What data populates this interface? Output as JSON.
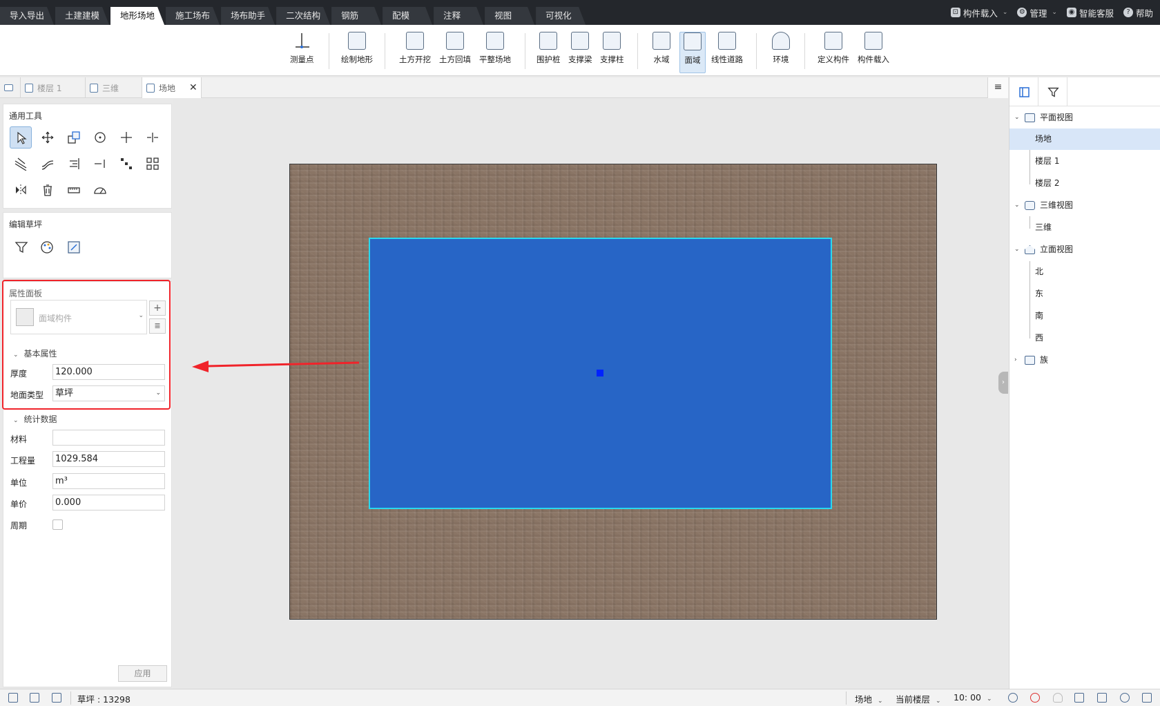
{
  "menubar": {
    "tabs": [
      "导入导出",
      "土建建模",
      "地形场地",
      "施工场布",
      "场布助手",
      "二次结构",
      "钢筋",
      "配模",
      "注释",
      "视图",
      "可视化"
    ],
    "active_tab": "地形场地",
    "right": {
      "component_load": "构件载入",
      "manage": "管理",
      "smart_service": "智能客服",
      "help": "帮助"
    }
  },
  "ribbon": {
    "survey_point": "测量点",
    "draw_terrain": "绘制地形",
    "excavation": "土方开挖",
    "backfill": "土方回填",
    "level_site": "平整场地",
    "retaining_pile": "围护桩",
    "support_beam": "支撑梁",
    "support_column": "支撑柱",
    "water_area": "水域",
    "surface_area": "面域",
    "linear_road": "线性道路",
    "environment": "环境",
    "define_component": "定义构件",
    "load_component": "构件载入",
    "selected": "面域"
  },
  "doc_tabs": {
    "floor1": "楼层 1",
    "view3d": "三维",
    "site": "场地"
  },
  "left_panel": {
    "general_tools_title": "通用工具",
    "edit_lawn_title": "编辑草坪",
    "property_panel_title": "属性面板",
    "component_selector": "面域构件",
    "basic_properties": "基本属性",
    "thickness_label": "厚度",
    "thickness_value": "120.000",
    "ground_type_label": "地面类型",
    "ground_type_value": "草坪",
    "statistics": "统计数据",
    "material_label": "材料",
    "material_value": "",
    "quantity_label": "工程量",
    "quantity_value": "1029.584",
    "unit_label": "单位",
    "unit_value": "m³",
    "price_label": "单价",
    "price_value": "0.000",
    "period_label": "周期",
    "apply_button": "应用"
  },
  "right_panel": {
    "plan_view": "平面视图",
    "site": "场地",
    "floor1": "楼层 1",
    "floor2": "楼层 2",
    "view3d_group": "三维视图",
    "view3d": "三维",
    "elevation_view": "立面视图",
    "north": "北",
    "east": "东",
    "south": "南",
    "west": "西",
    "family": "族"
  },
  "statusbar": {
    "selection_info": "草坪 : 13298",
    "site": "场地",
    "current_floor": "当前楼层",
    "time": "10: 00"
  },
  "colors": {
    "area_fill": "#2765c6",
    "area_border": "#29d8ee",
    "highlight_box": "#f0232a",
    "menubar_bg": "#24272c"
  }
}
